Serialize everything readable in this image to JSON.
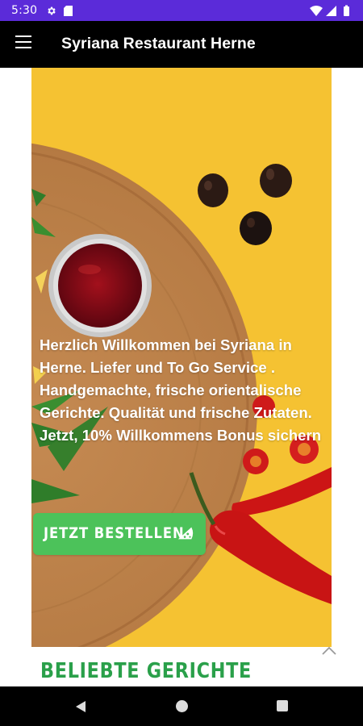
{
  "status_bar": {
    "time": "5:30",
    "icons": [
      "gear-icon",
      "sd-card-icon",
      "wifi-icon",
      "signal-icon",
      "battery-icon"
    ],
    "background": "#5b2bd9"
  },
  "app_bar": {
    "title": "Syriana Restaurant Herne",
    "menu_icon": "hamburger-menu-icon",
    "background": "#000000"
  },
  "hero": {
    "text": "Herzlich Willkommen bei Syriana in Herne. Liefer und To Go Service . Handgemachte, frische orientalische Gerichte. Qualität und frische Zutaten. Jetzt, 10% Willkommens Bonus sichern",
    "cta_label": "JETZT BESTELLEN",
    "cta_icon": "pizza-slice-icon",
    "cta_color": "#4cc25a",
    "background_color": "#f5c232"
  },
  "section": {
    "title": "BELIEBTE GERICHTE",
    "title_color": "#2aa04a"
  },
  "scroll_up_icon": "chevron-up-icon",
  "nav_bar": {
    "buttons": [
      "back-icon",
      "home-icon",
      "recent-apps-icon"
    ]
  }
}
